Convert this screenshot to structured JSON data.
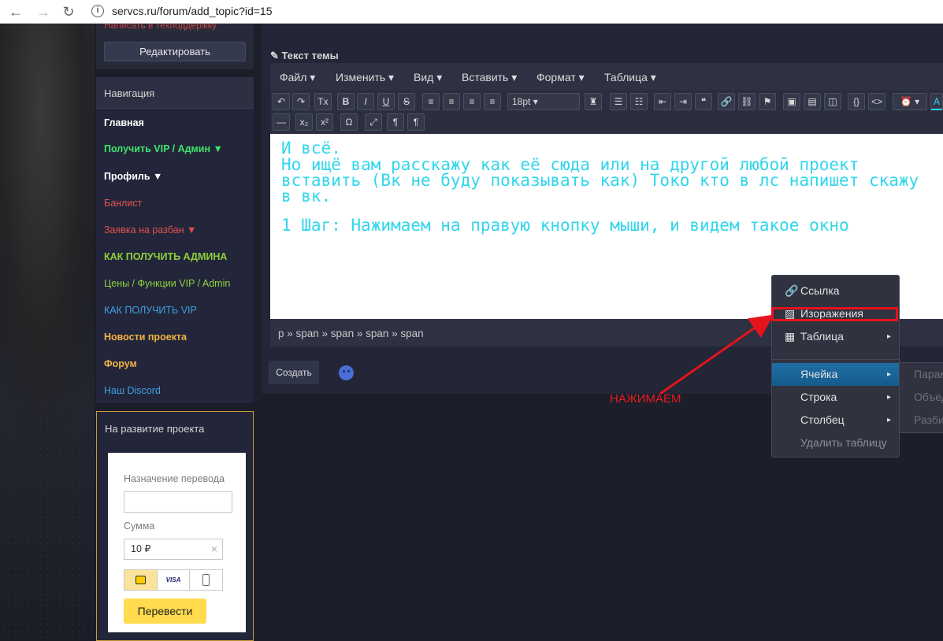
{
  "browser": {
    "back": "←",
    "forward": "→",
    "reload": "↻",
    "info": "i",
    "url": "servcs.ru/forum/add_topic?id=15"
  },
  "sidebar": {
    "top_link": "Написать в техподдержку",
    "edit_button": "Редактировать",
    "nav_title": "Навигация",
    "nav_items": [
      {
        "label": "Главная",
        "color": "#ffffff"
      },
      {
        "label": "Получить VIP / Админ ▼",
        "color": "#3fe46b"
      },
      {
        "label": "Профиль ▼",
        "color": "#ffffff"
      },
      {
        "label": "Банлист",
        "color": "#e2504c"
      },
      {
        "label": "Заявка на разбан ▼",
        "color": "#e2504c"
      },
      {
        "label": "КАК ПОЛУЧИТЬ АДМИНА",
        "color": "#8fcf3c"
      },
      {
        "label": "Цены / Функции VIP / Admin",
        "color": "#8fcf3c"
      },
      {
        "label": "КАК ПОЛУЧИТЬ VIP",
        "color": "#3e9fe3"
      },
      {
        "label": "Новости проекта",
        "color": "#f4b342"
      },
      {
        "label": "Форум",
        "color": "#f4b342"
      },
      {
        "label": "Наш Discord",
        "color": "#3e9fe3"
      }
    ],
    "donate_title": "На развитие проекта",
    "donate": {
      "purpose_label": "Назначение перевода",
      "purpose_value": "",
      "amount_label": "Сумма",
      "amount_value": "10 ₽",
      "clear": "×",
      "card_label": "VISA",
      "submit": "Перевести"
    }
  },
  "editor": {
    "topic_label": "Текст темы",
    "menu": [
      "Файл ▾",
      "Изменить ▾",
      "Вид ▾",
      "Вставить ▾",
      "Формат ▾",
      "Таблица ▾"
    ],
    "toolbar1": [
      "↶",
      "↷",
      "Tx",
      "B",
      "I",
      "U",
      "S",
      "≡",
      "≡",
      "≡",
      "≡",
      "18pt ▾",
      "♜",
      "☰",
      "☷",
      "⇤",
      "⇥",
      "❝",
      "🔗",
      "⛓",
      "⚑",
      "▣",
      "▤",
      "◫",
      "{}",
      "<>",
      "⏰ ▾",
      "A"
    ],
    "toolbar2": [
      "—",
      "x₂",
      "x²",
      "Ω",
      "⤢",
      "¶",
      "¶"
    ],
    "content_lines": [
      "И всё.",
      "Но ищё вам расскажу как её сюда или на другой любой проект",
      "вставить (Вк не буду показывать как) Токо кто в лс напишет скажу",
      "в вк.",
      "1 Шаг: Нажимаем на правую кнопку мыши, и видем такое окно"
    ],
    "path": "p » span » span » span » span",
    "create_button": "Создать"
  },
  "context_menu": {
    "items": [
      {
        "label": "Ссылка",
        "icon": "link-icon",
        "glyph": "🔗"
      },
      {
        "label": "Изоражения",
        "icon": "image-icon",
        "glyph": "▨"
      },
      {
        "label": "Таблица",
        "icon": "table-icon",
        "glyph": "▦",
        "arrow": "▸"
      },
      {
        "label": "Ячейка",
        "arrow": "▸"
      },
      {
        "label": "Строка",
        "arrow": "▸"
      },
      {
        "label": "Столбец",
        "arrow": "▸"
      },
      {
        "label": "Удалить таблицу"
      }
    ],
    "submenu": [
      "Парам",
      "Объед",
      "Разби"
    ]
  },
  "annotation": "НАЖИМАЕМ"
}
